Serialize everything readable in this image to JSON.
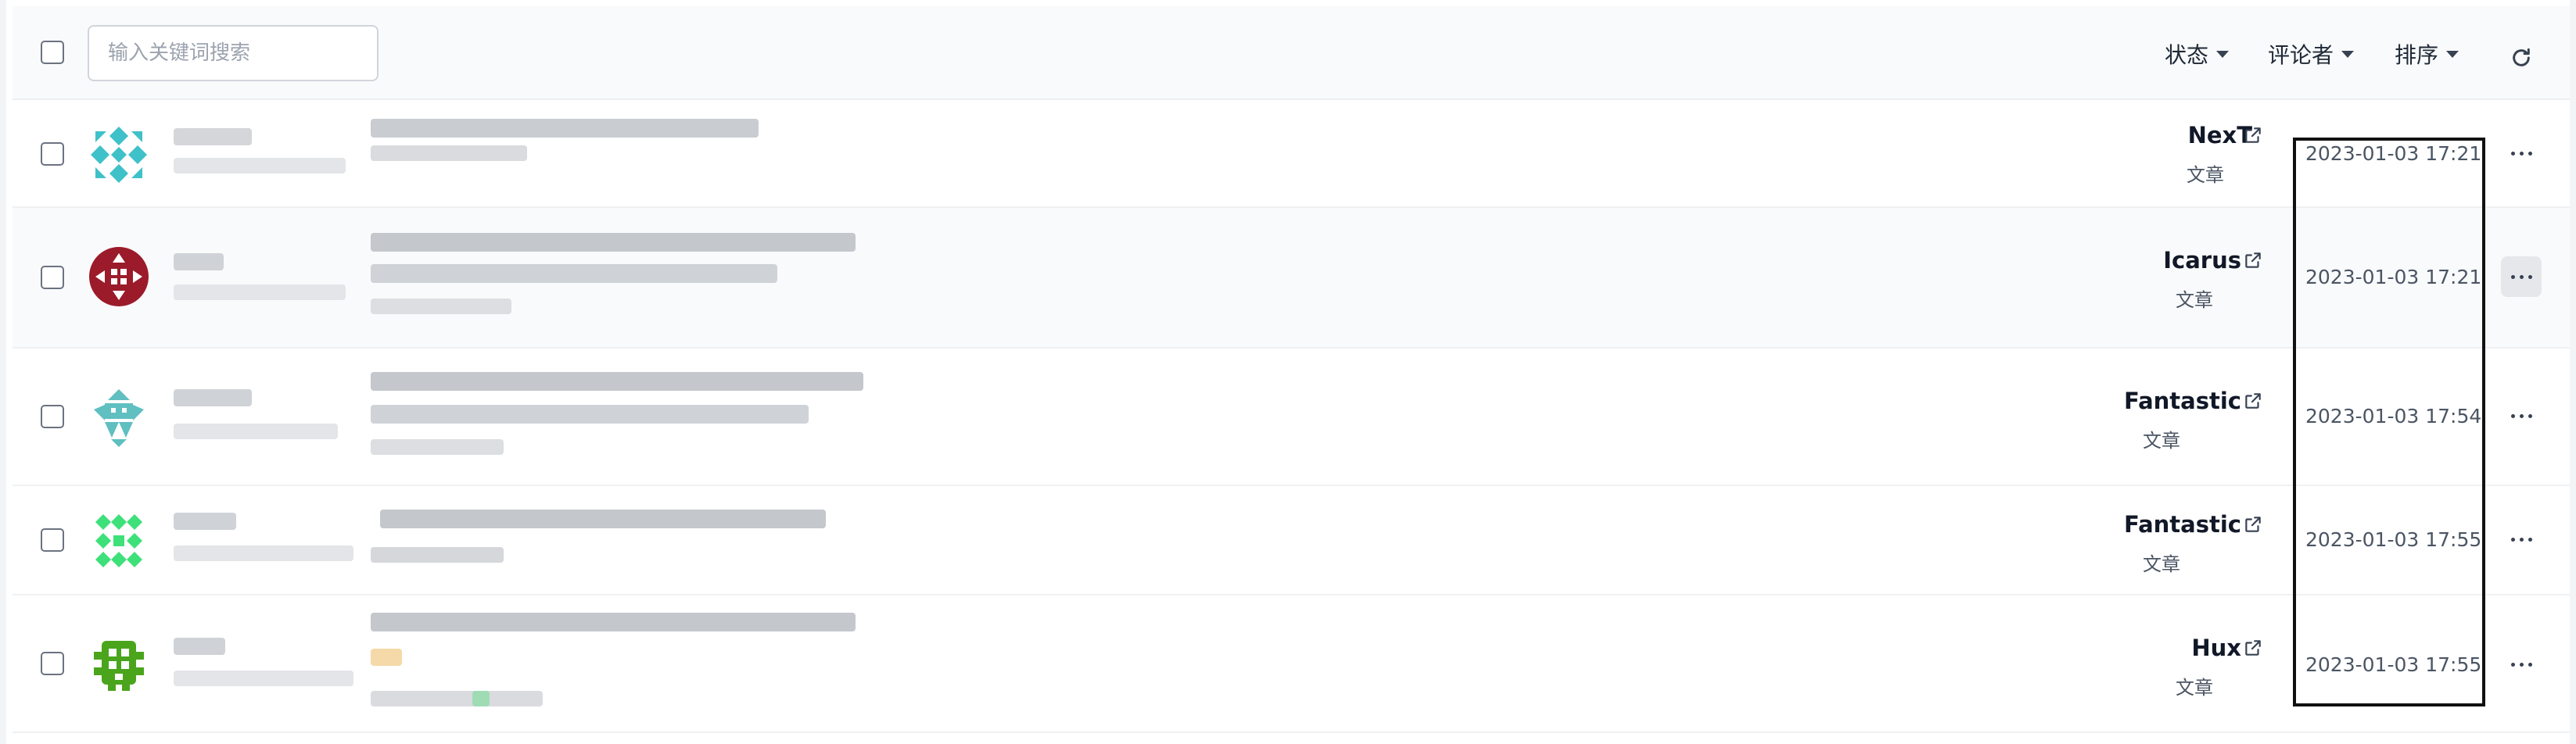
{
  "toolbar": {
    "search_placeholder": "输入关键词搜索",
    "filter_status": "状态",
    "filter_commenter": "评论者",
    "filter_sort": "排序",
    "refresh_icon": "refresh-icon"
  },
  "comments": [
    {
      "subject": "NexT",
      "type": "文章",
      "time": "2023-01-03 17:21",
      "avatar_color": "#3fc1c9"
    },
    {
      "subject": "Icarus",
      "type": "文章",
      "time": "2023-01-03 17:21",
      "avatar_color": "#9b1b2a"
    },
    {
      "subject": "Fantastic",
      "type": "文章",
      "time": "2023-01-03 17:54",
      "avatar_color": "#5fbfc1"
    },
    {
      "subject": "Fantastic",
      "type": "文章",
      "time": "2023-01-03 17:55",
      "avatar_color": "#3ee07a"
    },
    {
      "subject": "Hux",
      "type": "文章",
      "time": "2023-01-03 17:55",
      "avatar_color": "#4aa51c"
    }
  ],
  "colors": {
    "accent_border": "#111111",
    "row_hover": "#f9fafb"
  }
}
